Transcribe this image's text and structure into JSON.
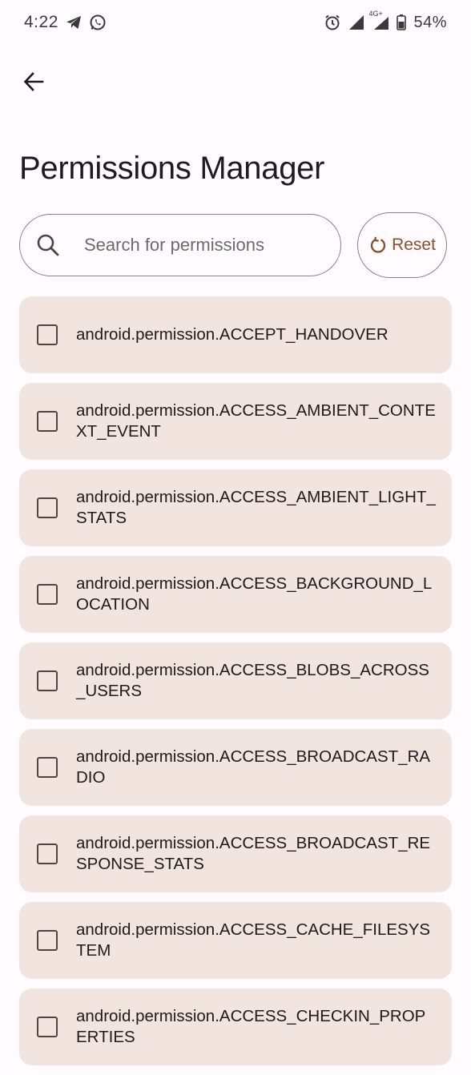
{
  "status_bar": {
    "time": "4:22",
    "battery_percent": "54%",
    "network_label": "4G+",
    "icons": [
      "telegram-icon",
      "whatsapp-icon",
      "alarm-icon",
      "signal-icon",
      "signal-4g-icon",
      "battery-icon"
    ]
  },
  "header": {
    "title": "Permissions Manager"
  },
  "search": {
    "placeholder": "Search for permissions",
    "value": ""
  },
  "reset_label": "Reset",
  "colors": {
    "accent": "#8a4f2a",
    "card_bg": "#f2e4df",
    "background": "#fffbfe"
  },
  "permissions": [
    {
      "name": "android.permission.ACCEPT_HANDOVER",
      "checked": false
    },
    {
      "name": "android.permission.ACCESS_AMBIENT_CONTEXT_EVENT",
      "checked": false
    },
    {
      "name": "android.permission.ACCESS_AMBIENT_LIGHT_STATS",
      "checked": false
    },
    {
      "name": "android.permission.ACCESS_BACKGROUND_LOCATION",
      "checked": false
    },
    {
      "name": "android.permission.ACCESS_BLOBS_ACROSS_USERS",
      "checked": false
    },
    {
      "name": "android.permission.ACCESS_BROADCAST_RADIO",
      "checked": false
    },
    {
      "name": "android.permission.ACCESS_BROADCAST_RESPONSE_STATS",
      "checked": false
    },
    {
      "name": "android.permission.ACCESS_CACHE_FILESYSTEM",
      "checked": false
    },
    {
      "name": "android.permission.ACCESS_CHECKIN_PROPERTIES",
      "checked": false
    }
  ]
}
